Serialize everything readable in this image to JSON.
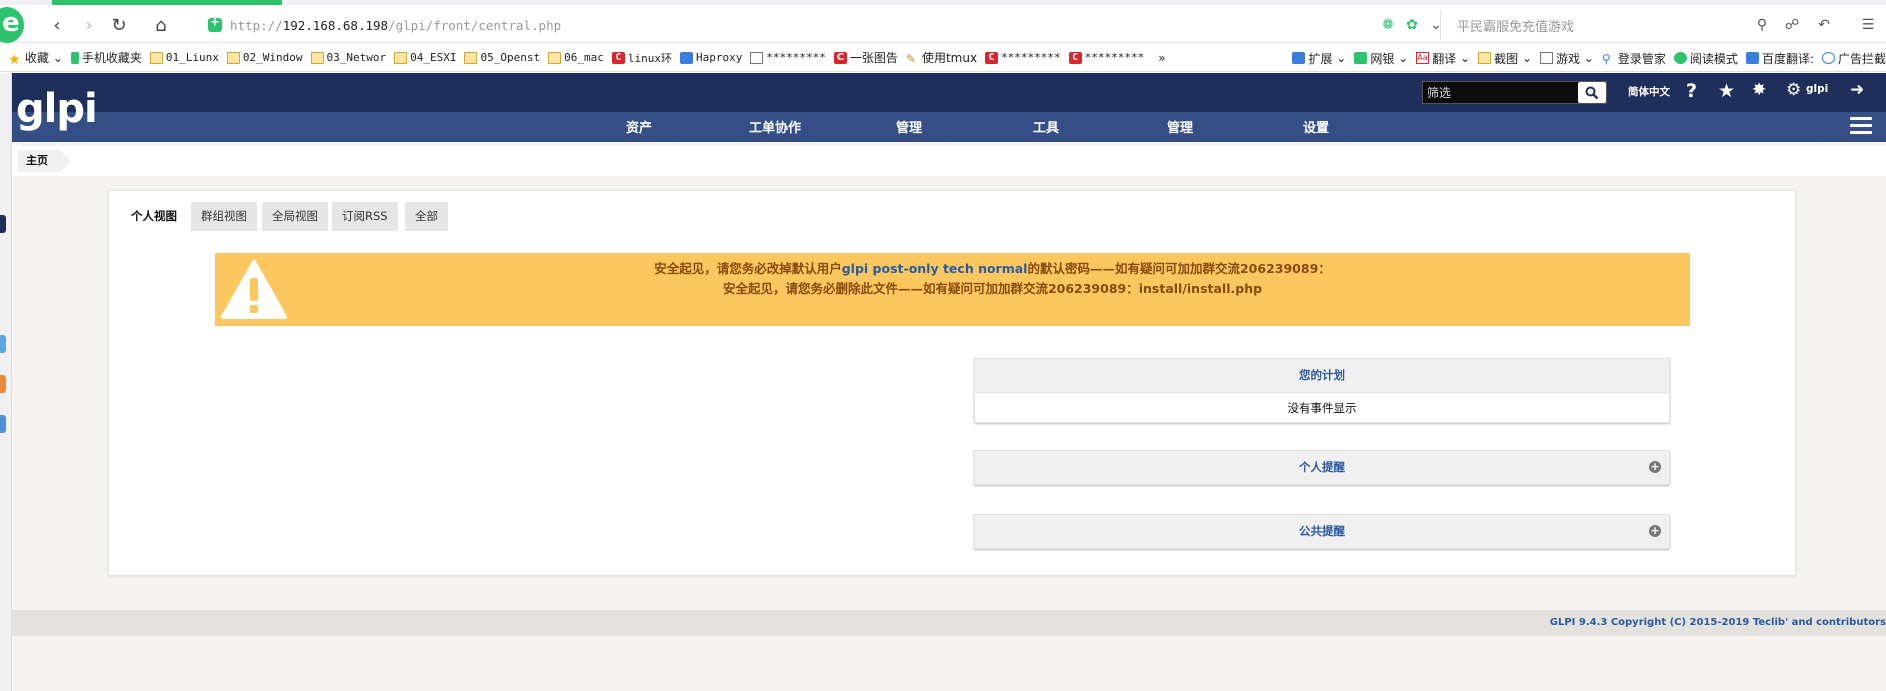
{
  "browser": {
    "url_scheme": "http://",
    "url_host": "192.168.68.198",
    "url_path": "/glpi/front/central.php",
    "search_placeholder": "平民霸服免充值游戏",
    "bookmarks": [
      "收藏",
      "手机收藏夹",
      "01_Liunx",
      "02_Window",
      "03_Networ",
      "04_ESXI",
      "05_Openst",
      "06_mac",
      "linux环",
      "Haproxy",
      "*********",
      "一张图告",
      "使用tmux",
      "*********",
      "*********"
    ],
    "bookmarks_more": "»",
    "toolbar_right": [
      "扩展",
      "网银",
      "翻译",
      "截图",
      "游戏",
      "登录管家",
      "阅读模式",
      "百度翻译:",
      "广告拦截"
    ]
  },
  "header": {
    "logo_text": "glpi",
    "filter_placeholder": "筛选",
    "language": "简体中文",
    "user": "glpi"
  },
  "menu": [
    "资产",
    "工单协作",
    "管理",
    "工具",
    "管理",
    "设置"
  ],
  "breadcrumb": {
    "home": "主页"
  },
  "tabs": [
    "个人视图",
    "群组视图",
    "全局视图",
    "订阅RSS",
    "全部"
  ],
  "alert": {
    "line1_before": "安全起见，请您务必改掉默认用户",
    "line1_users": "glpi post-only tech normal",
    "line1_after": "的默认密码——如有疑问可加加群交流206239089：",
    "line2_before": "安全起见，请您务必删除此文件——如有疑问可加加群交流206239089：",
    "line2_file": "install/install.php"
  },
  "widgets": {
    "planning_title": "您的计划",
    "planning_empty": "没有事件显示",
    "personal_reminders": "个人提醒",
    "public_reminders": "公共提醒"
  },
  "footer": {
    "copyright": "GLPI 9.4.3 Copyright (C) 2015-2019 Teclib' and contributors"
  }
}
